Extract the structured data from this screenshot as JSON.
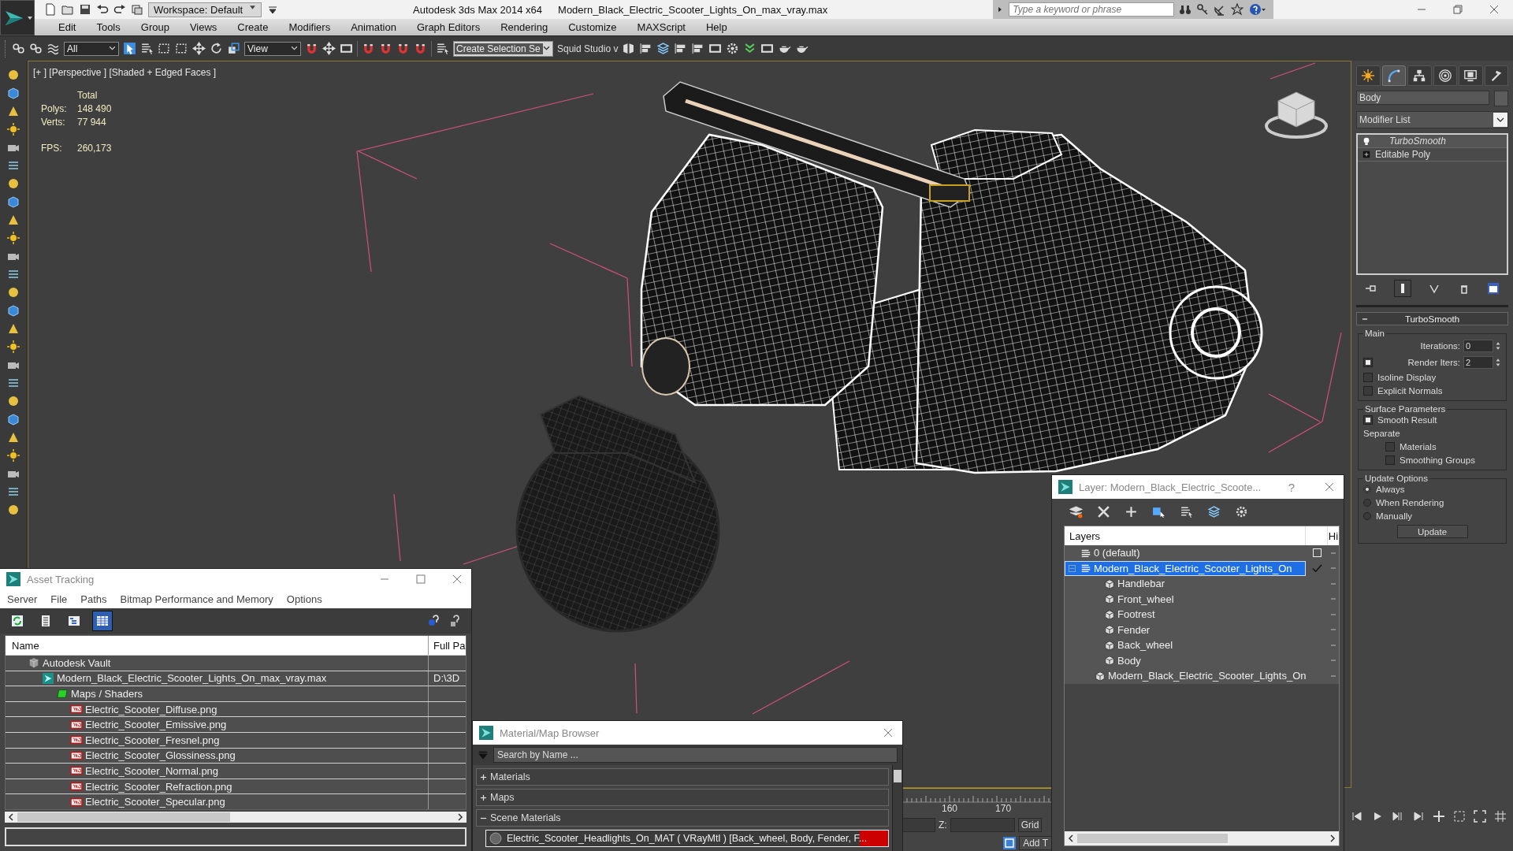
{
  "title_bar": {
    "workspace": "Workspace: Default",
    "app_title": "Autodesk 3ds Max  2014 x64",
    "file_name": "Modern_Black_Electric_Scooter_Lights_On_max_vray.max",
    "search": {
      "placeholder": "Type a keyword or phrase"
    }
  },
  "menu": [
    "Edit",
    "Tools",
    "Group",
    "Views",
    "Create",
    "Modifiers",
    "Animation",
    "Graph Editors",
    "Rendering",
    "Customize",
    "MAXScript",
    "Help"
  ],
  "toolbar": {
    "selection_filter": "All",
    "reference_coord": "View",
    "selection_set": {
      "placeholder": "Create Selection Se"
    },
    "workspace_set": "Squid Studio v"
  },
  "viewport": {
    "label": "[+ ] [Perspective ] [Shaded + Edged Faces ]",
    "stats_title": "Total",
    "stats": [
      {
        "label": "Polys:",
        "value": "148 490"
      },
      {
        "label": "Verts:",
        "value": "77 944"
      }
    ],
    "fps_label": "FPS:",
    "fps": "260,173"
  },
  "command_panel": {
    "tabs": [
      {
        "kind": "create",
        "selected": false
      },
      {
        "kind": "modify",
        "selected": true
      },
      {
        "kind": "hierarchy",
        "selected": false
      },
      {
        "kind": "motion",
        "selected": false
      },
      {
        "kind": "display",
        "selected": false
      },
      {
        "kind": "utilities",
        "selected": false
      }
    ],
    "object_name": "Body",
    "modifier_list": "Modifier List",
    "stack": [
      {
        "label": "TurboSmooth",
        "kind": "modifier"
      },
      {
        "label": "Editable Poly",
        "kind": "base"
      }
    ],
    "rollout_title": "TurboSmooth",
    "groups": [
      {
        "title": "Main",
        "controls": [
          {
            "kind": "spinner",
            "label": "Iterations:",
            "value": "0"
          },
          {
            "kind": "check_spinner",
            "label": "Render Iters:",
            "value": "2",
            "checked": true
          },
          {
            "kind": "checkbox",
            "label": "Isoline Display",
            "checked": false
          },
          {
            "kind": "checkbox",
            "label": "Explicit Normals",
            "checked": false
          }
        ]
      },
      {
        "title": "Surface Parameters",
        "controls": [
          {
            "kind": "checkbox",
            "label": "Smooth Result",
            "checked": true
          },
          {
            "kind": "text",
            "label": "Separate"
          },
          {
            "kind": "subcheckbox",
            "label": "Materials",
            "checked": false
          },
          {
            "kind": "subcheckbox",
            "label": "Smoothing Groups",
            "checked": false
          }
        ]
      },
      {
        "title": "Update Options",
        "controls": [
          {
            "kind": "radio",
            "label": "Always",
            "selected": true
          },
          {
            "kind": "radio",
            "label": "When Rendering",
            "selected": false
          },
          {
            "kind": "radio",
            "label": "Manually",
            "selected": false
          },
          {
            "kind": "button",
            "label": "Update"
          }
        ]
      }
    ]
  },
  "timeline": {
    "ticks": [
      "160",
      "170"
    ],
    "z_label": "Z:",
    "grid": "Grid",
    "add": "Add T"
  },
  "asset_tracking": {
    "title": "Asset Tracking",
    "menu": [
      "Server",
      "File",
      "Paths",
      "Bitmap Performance and Memory",
      "Options"
    ],
    "tools": [
      {
        "kind": "refresh",
        "selected": false
      },
      {
        "kind": "list",
        "selected": false
      },
      {
        "kind": "tree",
        "selected": false
      },
      {
        "kind": "table",
        "selected": true
      }
    ],
    "columns": [
      "Name",
      "Full Pa"
    ],
    "rows": [
      {
        "kind": "vault",
        "name": "Autodesk Vault",
        "children": [
          {
            "kind": "max",
            "name": "Modern_Black_Electric_Scooter_Lights_On_max_vray.max",
            "full_path": "D:\\3D",
            "children": [
              {
                "kind": "folder",
                "name": "Maps / Shaders",
                "children": [
                  {
                    "kind": "png",
                    "name": "Electric_Scooter_Diffuse.png"
                  },
                  {
                    "kind": "png",
                    "name": "Electric_Scooter_Emissive.png"
                  },
                  {
                    "kind": "png",
                    "name": "Electric_Scooter_Fresnel.png"
                  },
                  {
                    "kind": "png",
                    "name": "Electric_Scooter_Glossiness.png"
                  },
                  {
                    "kind": "png",
                    "name": "Electric_Scooter_Normal.png"
                  },
                  {
                    "kind": "png",
                    "name": "Electric_Scooter_Refraction.png"
                  },
                  {
                    "kind": "png",
                    "name": "Electric_Scooter_Specular.png"
                  }
                ]
              }
            ]
          }
        ]
      }
    ]
  },
  "material_browser": {
    "title": "Material/Map Browser",
    "search": {
      "placeholder": "Search by Name ..."
    },
    "groups": [
      {
        "label": "Materials",
        "expanded": false
      },
      {
        "label": "Maps",
        "expanded": false
      },
      {
        "label": "Scene Materials",
        "expanded": true,
        "items": [
          "Electric_Scooter_Headlights_On_MAT ( VRayMtl ) [Back_wheel, Body, Fender, F..."
        ]
      }
    ]
  },
  "layer_manager": {
    "title": "Layer: Modern_Black_Electric_Scoote...",
    "help": "?",
    "columns": [
      "Layers",
      "Hi"
    ],
    "layers": [
      {
        "kind": "layer",
        "label": "0 (default)",
        "selected": false,
        "current": false
      },
      {
        "kind": "layer",
        "label": "Modern_Black_Electric_Scooter_Lights_On",
        "selected": true,
        "current": true,
        "expanded": true,
        "children": [
          {
            "kind": "object",
            "label": "Handlebar",
            "selected": false
          },
          {
            "kind": "object",
            "label": "Front_wheel",
            "selected": false
          },
          {
            "kind": "object",
            "label": "Footrest",
            "selected": false
          },
          {
            "kind": "object",
            "label": "Fender",
            "selected": false
          },
          {
            "kind": "object",
            "label": "Back_wheel",
            "selected": false
          },
          {
            "kind": "object",
            "label": "Body",
            "selected": false
          },
          {
            "kind": "object",
            "label": "Modern_Black_Electric_Scooter_Lights_On",
            "selected": false
          }
        ]
      }
    ]
  }
}
